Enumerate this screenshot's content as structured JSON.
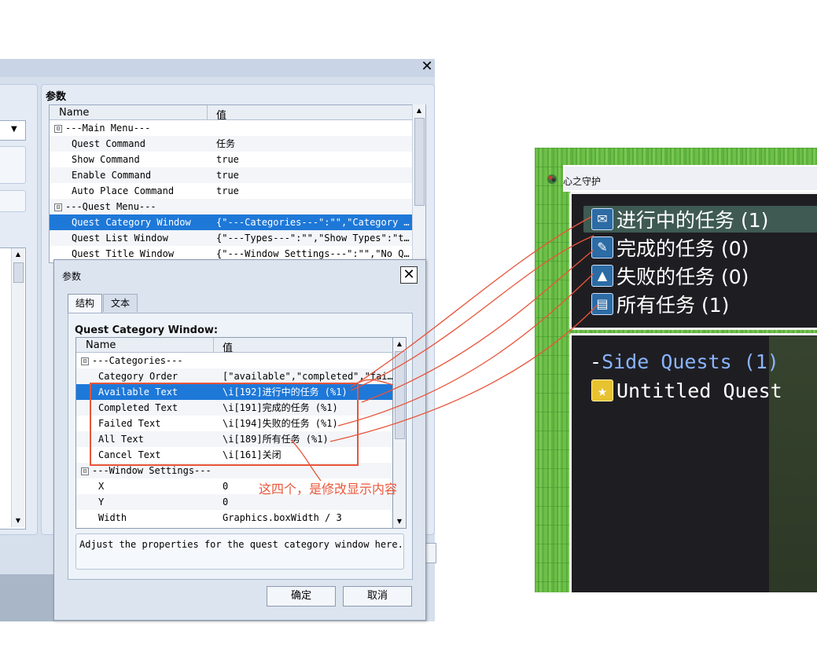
{
  "background_window": {
    "params_label": "参数",
    "columns": {
      "name": "Name",
      "value": "值"
    },
    "rows": [
      {
        "toggle": "⊟",
        "key": "---Main Menu---",
        "value": "",
        "indent": 0
      },
      {
        "key": "Quest Command",
        "value": "任务",
        "indent": 1
      },
      {
        "key": "Show Command",
        "value": "true",
        "indent": 1
      },
      {
        "key": "Enable Command",
        "value": "true",
        "indent": 1
      },
      {
        "key": "Auto Place Command",
        "value": "true",
        "indent": 1
      },
      {
        "toggle": "⊟",
        "key": "---Quest Menu---",
        "value": "",
        "indent": 0
      },
      {
        "key": "Quest Category Window",
        "value": "{\"---Categories---\":\"\",\"Category O…",
        "indent": 1,
        "selected": true
      },
      {
        "key": "Quest List Window",
        "value": "{\"---Types---\":\"\",\"Show Types\":\"tr…",
        "indent": 1
      },
      {
        "key": "Quest Title Window",
        "value": "{\"---Window Settings---\":\"\",\"No Qu…",
        "indent": 1
      }
    ]
  },
  "dialog": {
    "title": "参数",
    "tabs": [
      "结构",
      "文本"
    ],
    "section_label": "Quest Category Window:",
    "columns": {
      "name": "Name",
      "value": "值"
    },
    "rows": [
      {
        "toggle": "⊟",
        "key": "---Categories---",
        "value": "",
        "indent": 0
      },
      {
        "key": "Category Order",
        "value": "[\"available\",\"completed\",\"fai…",
        "indent": 1
      },
      {
        "key": "Available Text",
        "value": "\\i[192]进行中的任务 (%1)",
        "indent": 1,
        "selected": true
      },
      {
        "key": "Completed Text",
        "value": "\\i[191]完成的任务 (%1)",
        "indent": 1
      },
      {
        "key": "Failed Text",
        "value": "\\i[194]失败的任务 (%1)",
        "indent": 1
      },
      {
        "key": "All Text",
        "value": "\\i[189]所有任务 (%1)",
        "indent": 1
      },
      {
        "key": "Cancel Text",
        "value": "\\i[161]关闭",
        "indent": 1
      },
      {
        "toggle": "⊟",
        "key": "---Window Settings---",
        "value": "",
        "indent": 0
      },
      {
        "key": "X",
        "value": "0",
        "indent": 1
      },
      {
        "key": "Y",
        "value": "0",
        "indent": 1
      },
      {
        "key": "Width",
        "value": "Graphics.boxWidth / 3",
        "indent": 1
      }
    ],
    "description": "Adjust the properties for the quest category window here.",
    "ok_label": "确定",
    "cancel_label": "取消"
  },
  "annotation": {
    "text": "这四个，是修改显示内容",
    "color": "#e8553a"
  },
  "game": {
    "window_title": "心之守护",
    "categories": [
      {
        "icon": "envelope-icon",
        "label": "进行中的任务 (1)"
      },
      {
        "icon": "scroll-icon",
        "label": "完成的任务 (0)"
      },
      {
        "icon": "ruins-icon",
        "label": "失败的任务 (0)"
      },
      {
        "icon": "book-icon",
        "label": "所有任务 (1)"
      }
    ],
    "list_type_prefix": "-",
    "list_type": "Side Quests (1)",
    "quest_item": "Untitled Quest"
  },
  "colors": {
    "selection": "#1e78d8",
    "panel_bg": "#d6dfec",
    "game_window_bg": "#1e1e22",
    "side_quest_text": "#8ab4ff"
  }
}
